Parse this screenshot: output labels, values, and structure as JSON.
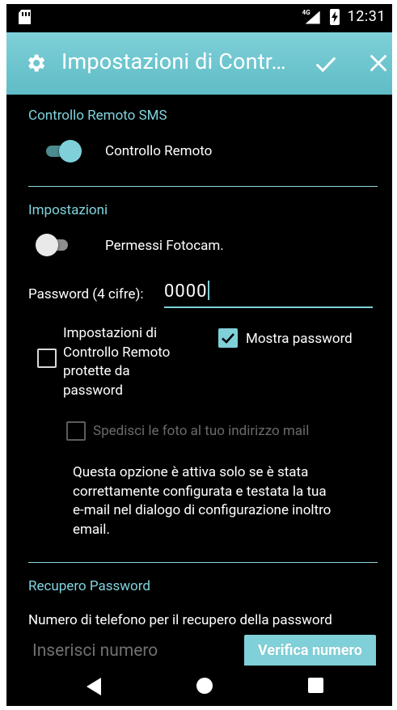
{
  "status_bar": {
    "time": "12:31",
    "network_label": "4G",
    "icons": [
      "sd-card-icon",
      "signal-icon",
      "battery-charging-icon"
    ]
  },
  "app_bar": {
    "title": "Impostazioni di Contr…",
    "icon": "gear-icon",
    "confirm_icon": "check-icon",
    "close_icon": "close-icon",
    "color": "#7fd0d8"
  },
  "sms_section": {
    "title": "Controllo Remoto SMS",
    "remote_control_label": "Controllo Remoto",
    "remote_control_on": true
  },
  "settings_section": {
    "title": "Impostazioni",
    "camera_permission_label": "Permessi Fotocam.",
    "camera_permission_on": false,
    "password_label": "Password (4 cifre):",
    "password_value": "0000",
    "protect_label": [
      "Impostazioni di",
      "Controllo Remoto",
      "protette da",
      "password"
    ],
    "protect_checked": false,
    "show_password_label": "Mostra password",
    "show_password_checked": true,
    "send_photos_label": "Spedisci le foto al tuo indirizzo mail",
    "send_photos_enabled": false,
    "info_lines": [
      "Questa opzione è attiva solo se è stata",
      "correttamente configurata e testata la tua",
      "e-mail nel dialogo di configurazione inoltro",
      "email."
    ]
  },
  "recovery_section": {
    "title": "Recupero Password",
    "description": "Numero di telefono per il recupero della password",
    "phone_placeholder": "Inserisci numero",
    "verify_button": "Verifica numero"
  },
  "nav_bar": {
    "icons": [
      "back-icon",
      "home-icon",
      "recents-icon"
    ]
  },
  "colors": {
    "accent": "#7fd0d8",
    "background": "#000000",
    "section_title": "#81d4df"
  }
}
